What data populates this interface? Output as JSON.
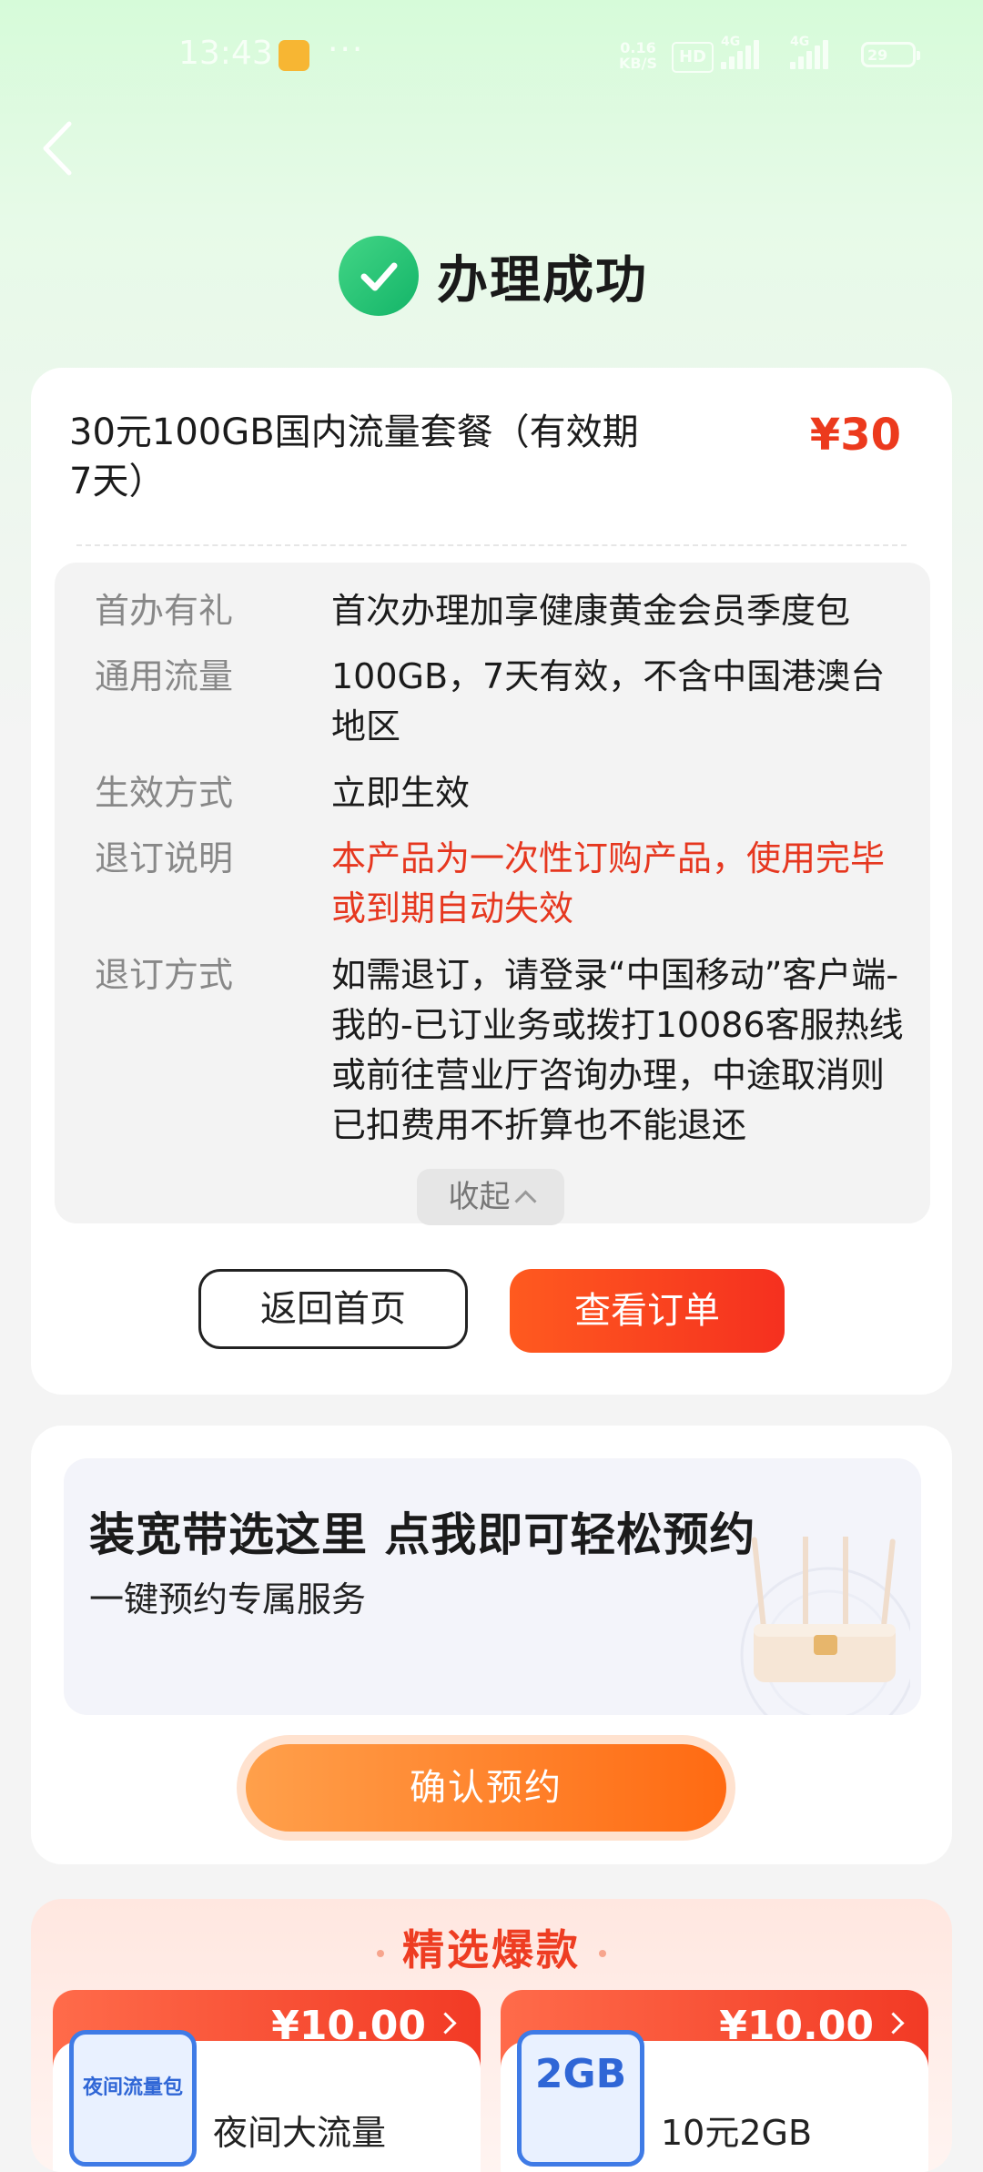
{
  "status_bar": {
    "time": "13:43",
    "net_speed_top": "0.16",
    "net_speed_unit": "KB/S",
    "hd_label": "HD",
    "signal1_label": "4G",
    "signal2_label": "4G",
    "battery_level": "29"
  },
  "header": {
    "back_icon": "chevron-left-icon",
    "success_title": "办理成功"
  },
  "order": {
    "product_name": "30元100GB国内流量套餐（有效期7天）",
    "price": "¥30",
    "details": [
      {
        "key": "首办有礼",
        "value": "首次办理加享健康黄金会员季度包"
      },
      {
        "key": "通用流量",
        "value": "100GB，7天有效，不含中国港澳台地区"
      },
      {
        "key": "生效方式",
        "value": "立即生效"
      },
      {
        "key": "退订说明",
        "value": "本产品为一次性订购产品，使用完毕或到期自动失效"
      },
      {
        "key": "退订方式",
        "value": "如需退订，请登录“中国移动”客户端-我的-已订业务或拨打10086客服热线或前往营业厅咨询办理，中途取消则已扣费用不折算也不能退还"
      }
    ],
    "collapse_label": "收起",
    "home_button": "返回首页",
    "view_order_button": "查看订单"
  },
  "broadband": {
    "title": "装宽带选这里 点我即可轻松预约",
    "subtitle": "一键预约专属服务",
    "confirm_button": "确认预约"
  },
  "hot_picks": {
    "title": "精选爆款",
    "items": [
      {
        "price": "¥10.00",
        "thumb_label": "夜间流量包",
        "name": "夜间大流量"
      },
      {
        "price": "¥10.00",
        "thumb_label": "2GB",
        "name": "10元2GB"
      }
    ]
  },
  "colors": {
    "accent_red": "#ec3a1d",
    "success_green": "#1bbd6e",
    "reserve_orange": "#ff7a22"
  }
}
